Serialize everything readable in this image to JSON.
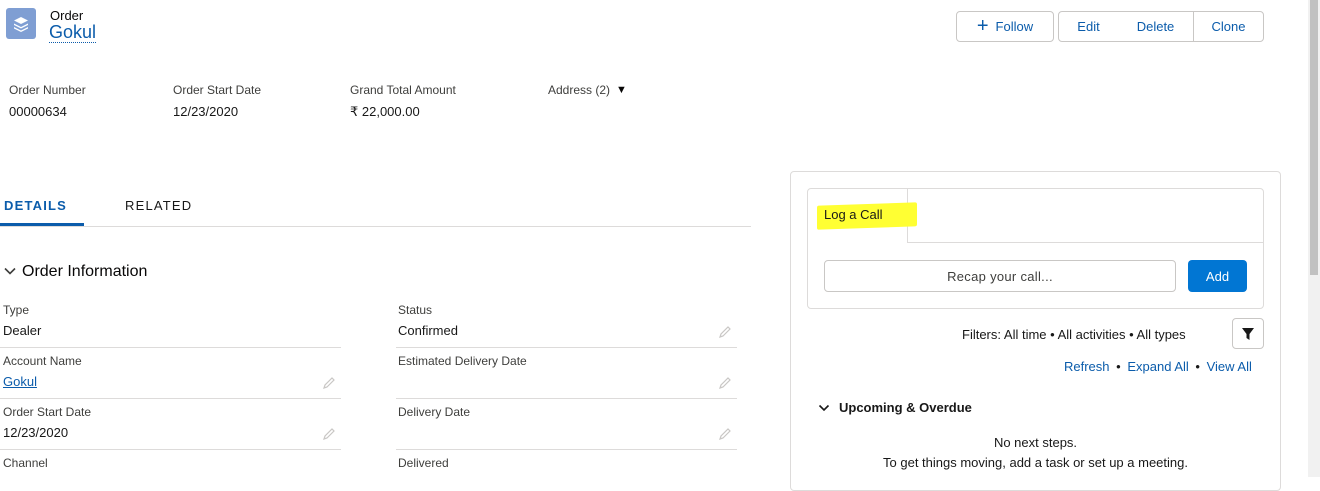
{
  "header": {
    "object_type": "Order",
    "record_name": "Gokul",
    "icon": "stack-layers-icon",
    "actions": {
      "follow": "Follow",
      "edit": "Edit",
      "delete": "Delete",
      "clone": "Clone"
    }
  },
  "highlights": [
    {
      "label": "Order Number",
      "value": "00000634"
    },
    {
      "label": "Order Start Date",
      "value": "12/23/2020"
    },
    {
      "label": "Grand Total Amount",
      "value": "₹ 22,000.00"
    },
    {
      "label": "Address (2)",
      "value": ""
    }
  ],
  "tabs": {
    "details": "DETAILS",
    "related": "RELATED",
    "active": "details"
  },
  "section": {
    "title": "Order Information",
    "left_fields": [
      {
        "label": "Type",
        "value": "Dealer"
      },
      {
        "label": "Account Name",
        "value": "Gokul"
      },
      {
        "label": "Order Start Date",
        "value": "12/23/2020"
      },
      {
        "label": "Channel",
        "value": ""
      }
    ],
    "right_fields": [
      {
        "label": "Status",
        "value": "Confirmed"
      },
      {
        "label": "Estimated Delivery Date",
        "value": ""
      },
      {
        "label": "Delivery Date",
        "value": ""
      },
      {
        "label": "Delivered",
        "value": ""
      }
    ]
  },
  "activity": {
    "composer_tab": "Log a Call",
    "recap_placeholder": "Recap your call...",
    "add_label": "Add",
    "filters": "Filters: All time • All activities • All types",
    "links": {
      "refresh": "Refresh",
      "expand_all": "Expand All",
      "view_all": "View All",
      "sep": "•"
    },
    "upcoming_title": "Upcoming & Overdue",
    "no_next": "No next steps.",
    "hint": "To get things moving, add a task or set up a meeting."
  },
  "colors": {
    "brand_blue": "#0b5cab",
    "button_blue": "#0176d3",
    "highlight_yellow": "#ffff33",
    "order_icon": "#7f9ed3"
  }
}
